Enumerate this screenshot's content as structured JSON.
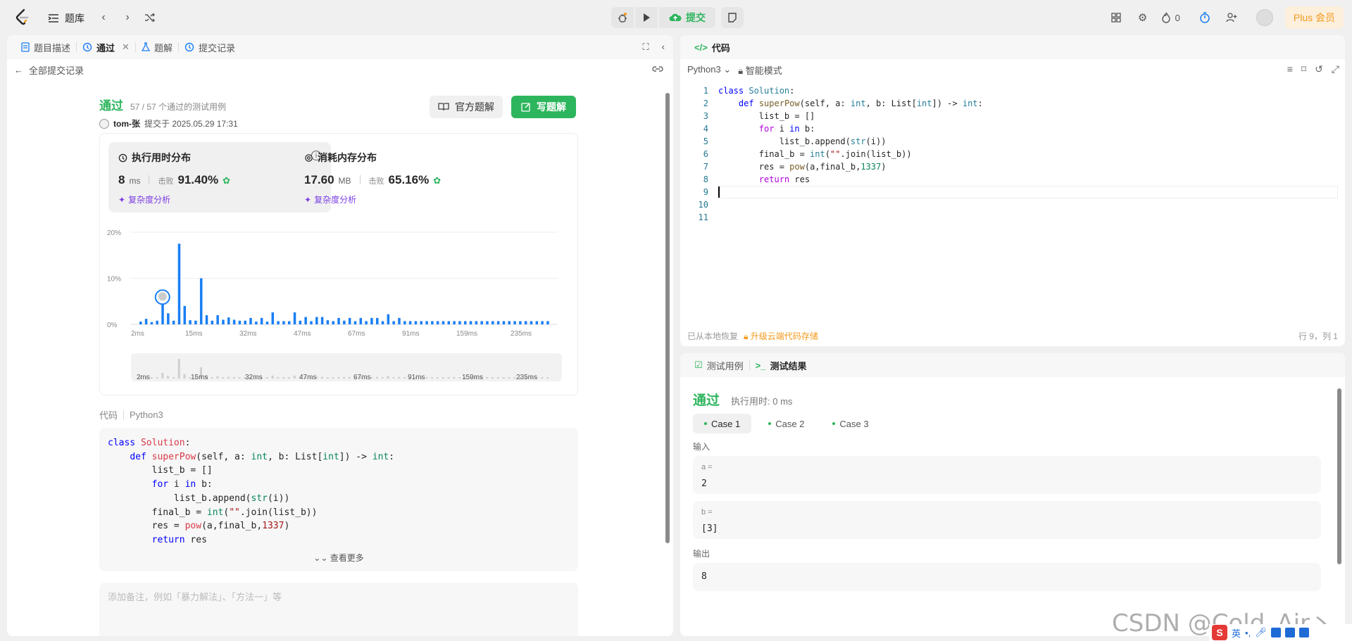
{
  "nav": {
    "problems_label": "题库",
    "submit_label": "提交",
    "fire_count": "0",
    "plus_label": "Plus 会员"
  },
  "left": {
    "tabs": [
      {
        "label": "题目描述"
      },
      {
        "label": "通过"
      },
      {
        "label": "题解"
      },
      {
        "label": "提交记录"
      }
    ],
    "back_label": "全部提交记录",
    "status": "通过",
    "status_sub": "57 / 57 个通过的测试用例",
    "author": "tom-张",
    "submitted_at": "提交于 2025.05.29 17:31",
    "official_solution": "官方题解",
    "write_solution": "写题解",
    "runtime": {
      "title": "执行用时分布",
      "value": "8",
      "unit": "ms",
      "beats_label": "击败",
      "beats": "91.40%",
      "complexity": "复杂度分析"
    },
    "memory": {
      "title": "消耗内存分布",
      "value": "17.60",
      "unit": "MB",
      "beats_label": "击败",
      "beats": "65.16%",
      "complexity": "复杂度分析"
    },
    "code_label": "代码",
    "code_lang": "Python3",
    "see_more": "查看更多",
    "note_placeholder": "添加备注，例如「暴力解法」、「方法一」等"
  },
  "chart_data": {
    "type": "bar",
    "ylabels": [
      "20%",
      "10%",
      "0%"
    ],
    "ylim": [
      0,
      20
    ],
    "xlabels": [
      "2ms",
      "15ms",
      "32ms",
      "47ms",
      "67ms",
      "91ms",
      "159ms",
      "235ms"
    ],
    "values": [
      0.6,
      1.2,
      0.5,
      0.8,
      5.0,
      2.4,
      0.8,
      17.5,
      4.0,
      0.9,
      0.8,
      10.0,
      2.0,
      0.8,
      2.0,
      1.0,
      1.5,
      1.0,
      0.8,
      0.8,
      1.4,
      0.6,
      1.4,
      0.6,
      2.6,
      0.7,
      0.7,
      0.7,
      2.6,
      0.8,
      1.6,
      0.7,
      1.6,
      1.6,
      0.9,
      0.7,
      1.4,
      0.8,
      1.4,
      0.7,
      1.4,
      0.7,
      1.4,
      1.4,
      0.7,
      2.2,
      0.7,
      1.4,
      0.7,
      0.7,
      0.7,
      0.7,
      0.7,
      0.7,
      0.7,
      0.7,
      0.7,
      0.7,
      0.7,
      0.7,
      0.7,
      0.7,
      0.7,
      0.7,
      0.7,
      0.7,
      0.7,
      0.7,
      0.7,
      0.7,
      0.7,
      0.7,
      0.7,
      0.7,
      0.7
    ],
    "highlight_index": 4,
    "grid": true
  },
  "code": {
    "panel_title": "代码",
    "lang": "Python3",
    "mode": "智能模式",
    "restored": "已从本地恢复",
    "upgrade": "升级云端代码存储",
    "position": "行 9，列 1",
    "line_numbers": [
      "1",
      "2",
      "3",
      "4",
      "5",
      "6",
      "7",
      "8",
      "9",
      "10",
      "11"
    ]
  },
  "test": {
    "tabs": [
      {
        "label": "测试用例"
      },
      {
        "label": "测试结果"
      }
    ],
    "status": "通过",
    "runtime": "执行用时: 0 ms",
    "cases": [
      "Case 1",
      "Case 2",
      "Case 3"
    ],
    "input_label": "输入",
    "inputs": [
      {
        "name": "a =",
        "value": "2"
      },
      {
        "name": "b =",
        "value": "[3]"
      }
    ],
    "output_label": "输出",
    "output": "8"
  },
  "watermark": "CSDN @Cold_Air丶",
  "ime": {
    "lang": "英"
  },
  "colors": {
    "accent_green": "#2db55d",
    "accent_orange": "#f39b1c",
    "purple": "#7c3fe4",
    "bar_blue": "#1a7ef5"
  }
}
